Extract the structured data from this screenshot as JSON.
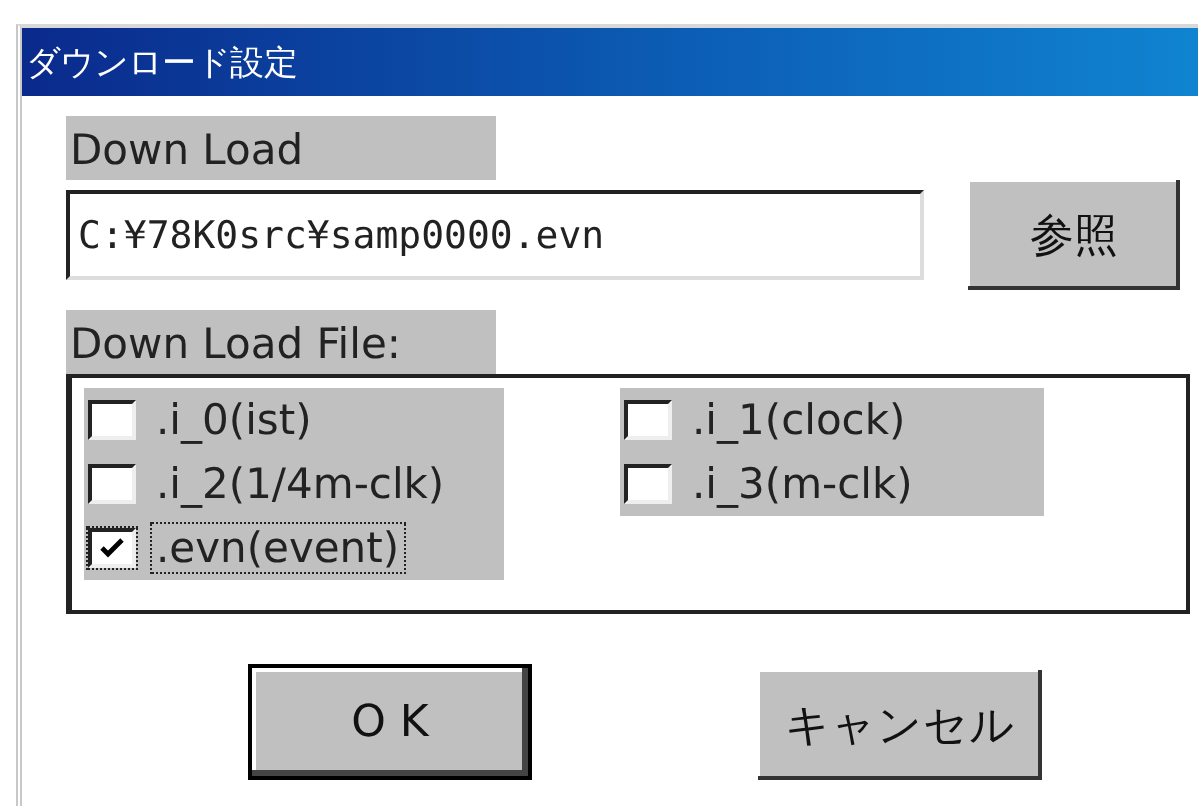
{
  "window": {
    "title": "ダウンロード設定"
  },
  "download": {
    "label": "Down Load",
    "value": "C:¥78K0src¥samp0000.evn",
    "browse_button": "参照"
  },
  "files": {
    "label": "Down Load File:",
    "options": [
      {
        "label": ".i_0(ist)",
        "checked": false,
        "focused": false
      },
      {
        "label": ".i_1(clock)",
        "checked": false,
        "focused": false
      },
      {
        "label": ".i_2(1/4m-clk)",
        "checked": false,
        "focused": false
      },
      {
        "label": ".i_3(m-clk)",
        "checked": false,
        "focused": false
      },
      {
        "label": ".evn(event)",
        "checked": true,
        "focused": true
      }
    ]
  },
  "buttons": [
    {
      "label": "O K",
      "default": true
    },
    {
      "label": "キャンセル",
      "default": false
    }
  ]
}
